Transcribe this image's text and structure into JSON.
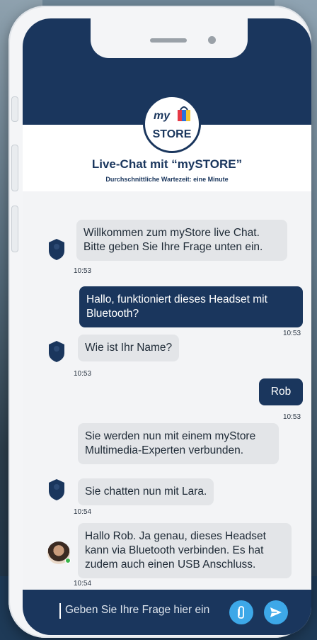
{
  "header": {
    "logo_my": "my",
    "logo_store": "STORE",
    "title": "Live-Chat mit “mySTORE”",
    "subtitle": "Durchschnittliche Wartezeit: eine Minute"
  },
  "messages": [
    {
      "from": "bot",
      "text": "Willkommen zum myStore live Chat. Bitte geben Sie Ihre Frage unten ein.",
      "time": "10:53"
    },
    {
      "from": "user",
      "text": "Hallo, funktioniert dieses Headset mit Bluetooth?",
      "time": "10:53"
    },
    {
      "from": "bot",
      "text": "Wie ist Ihr Name?",
      "time": "10:53"
    },
    {
      "from": "user",
      "text": "Rob",
      "time": "10:53"
    },
    {
      "from": "bot",
      "text": "Sie werden nun mit einem myStore Multimedia-Experten verbunden.",
      "time": ""
    },
    {
      "from": "bot",
      "text": "Sie chatten nun mit Lara.",
      "time": "10:54"
    },
    {
      "from": "agent",
      "text": "Hallo Rob. Ja genau, dieses Headset kann via Bluetooth verbinden. Es hat zudem auch einen USB Anschluss.",
      "time": "10:54"
    }
  ],
  "input": {
    "placeholder": "Geben Sie Ihre Frage hier ein"
  },
  "icons": {
    "bot_avatar": "shield-user-icon",
    "attach": "paperclip-icon",
    "send": "send-icon"
  },
  "colors": {
    "navy": "#1a365d",
    "accent": "#3da8e8",
    "bot_bubble": "#e3e5e8"
  }
}
